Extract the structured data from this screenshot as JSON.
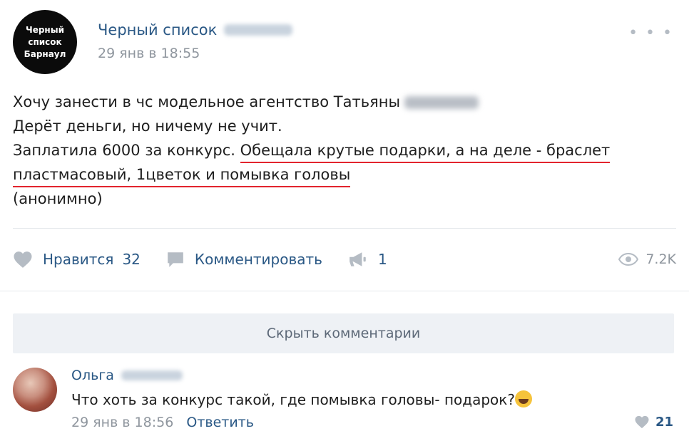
{
  "post": {
    "avatar_lines": [
      "Черный",
      "список",
      "Барнаул"
    ],
    "author": "Черный список",
    "date": "29 янв в 18:55",
    "more_icon": "more-dots-icon",
    "text": {
      "line1": "Хочу занести в чс модельное агентство Татьяны",
      "line2": "Дерёт деньги, но ничему не учит.",
      "line3_plain": "Заплатила 6000 за конкурс. ",
      "line3_underlined": "Обещала крутые подарки, а на деле - браслет",
      "line4_underlined": "пластмасовый, 1цветок и помывка головы",
      "line5": "(анонимно)"
    },
    "underline_color": "#e2242e"
  },
  "actions": {
    "like_label": "Нравится",
    "like_count": "32",
    "comment_label": "Комментировать",
    "share_count": "1",
    "views": "7.2K"
  },
  "comments": {
    "hide_label": "Скрыть комментарии",
    "items": [
      {
        "author": "Ольга",
        "text": "Что хоть за конкурс такой, где помывка головы- подарок?",
        "emoji": "joy-emoji-icon",
        "date": "29 янв в 18:56",
        "reply_label": "Ответить",
        "likes": "21"
      }
    ]
  },
  "colors": {
    "link": "#2a5885",
    "muted": "#8f969e",
    "icon": "#b5bcc4",
    "button_bg": "#eef1f5"
  }
}
